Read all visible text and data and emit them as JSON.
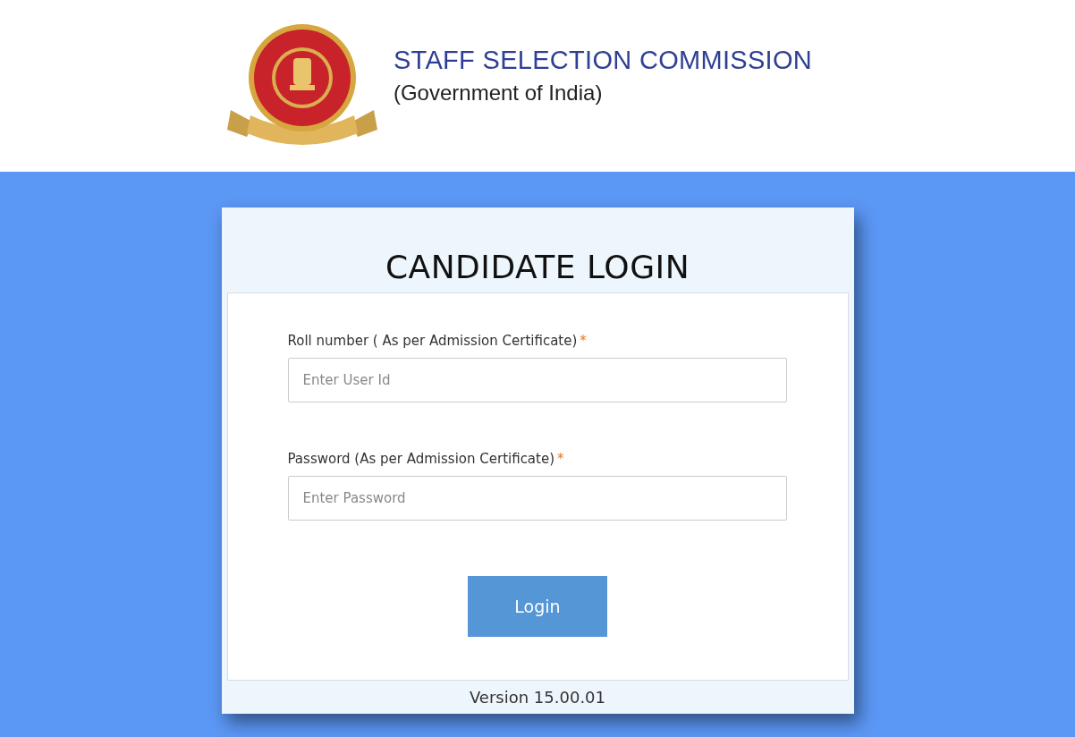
{
  "header": {
    "title": "STAFF SELECTION COMMISSION",
    "subtitle": "(Government of India)"
  },
  "login": {
    "title": "CANDIDATE LOGIN",
    "fields": [
      {
        "label": "Roll number ( As per Admission Certificate)",
        "required_mark": "*",
        "placeholder": "Enter User Id"
      },
      {
        "label": "Password (As per Admission Certificate)",
        "required_mark": "*",
        "placeholder": "Enter Password"
      }
    ],
    "button": "Login",
    "version": "Version 15.00.01"
  }
}
